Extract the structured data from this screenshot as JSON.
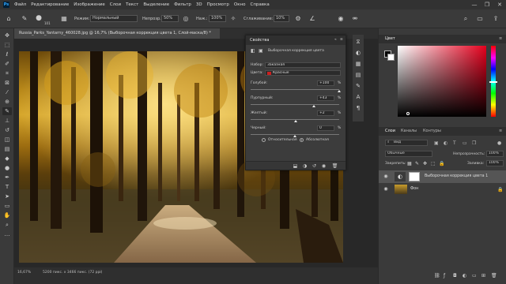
{
  "menubar": {
    "logo": "Ps",
    "items": [
      "Файл",
      "Редактирование",
      "Изображение",
      "Слои",
      "Текст",
      "Выделение",
      "Фильтр",
      "3D",
      "Просмотр",
      "Окно",
      "Справка"
    ],
    "controls": [
      "—",
      "❐",
      "✕"
    ]
  },
  "optionsbar": {
    "brush_size": "101",
    "mode_label": "Режим:",
    "mode_value": "Нормальный",
    "opacity_label": "Непрозр.:",
    "opacity_value": "50%",
    "pressure_label": "Наж.:",
    "pressure_value": "100%",
    "smoothing_label": "Сглаживание:",
    "smoothing_value": "10%"
  },
  "document": {
    "tab_title": "Russia_Parks_Yantarny_460028.jpg @ 16,7% (Выборочная коррекция цвета 1, Слой-маска/8) *",
    "zoom": "16,67%",
    "dimensions": "5200 пикс. x 3466 пикс. (72 ppi)"
  },
  "properties": {
    "panel_title": "Свойства",
    "adjustment_title": "Выборочная коррекция цвета",
    "preset_label": "Набор:",
    "preset_value": "Заказная",
    "colors_label": "Цвета:",
    "colors_value": "Красные",
    "colors_swatch": "#cc1f1f",
    "sliders": [
      {
        "label": "Голубой:",
        "value": "+100",
        "unit": "%",
        "fraction": 1.0
      },
      {
        "label": "Пурпурный:",
        "value": "+43",
        "unit": "%",
        "fraction": 0.715
      },
      {
        "label": "Желтый:",
        "value": "+2",
        "unit": "%",
        "fraction": 0.51
      },
      {
        "label": "Черный:",
        "value": "0",
        "unit": "%",
        "fraction": 0.5
      }
    ],
    "radio_relative": "Относительная",
    "radio_absolute": "Абсолютная",
    "selected_method": "absolute"
  },
  "right_panel": {
    "color_tab": "Цвет",
    "layers_tabs": [
      "Слои",
      "Каналы",
      "Контуры"
    ],
    "kind_label": "Вид",
    "blend_mode": "Обычные",
    "opacity_label": "Непрозрачность:",
    "opacity_value": "100%",
    "lock_label": "Закрепить:",
    "fill_label": "Заливка:",
    "fill_value": "100%",
    "layers": [
      {
        "name": "Выборочная коррекция цвета 1",
        "type": "adjustment"
      },
      {
        "name": "Фон",
        "type": "image"
      }
    ]
  },
  "colors": {
    "accent_red": "#e5001d",
    "panel_bg": "#3a3a3a",
    "dark_bg": "#282828"
  }
}
